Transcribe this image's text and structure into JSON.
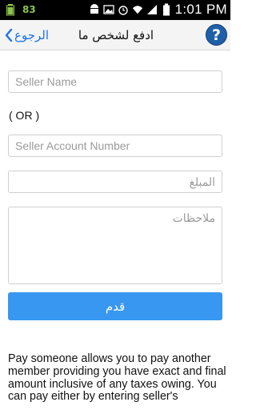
{
  "status_bar": {
    "left_number": "83",
    "time": "1:01",
    "time_suffix": "PM"
  },
  "header": {
    "back_label": "الرجوع",
    "title": "ادفع لشخص ما",
    "help_symbol": "?"
  },
  "form": {
    "seller_name_placeholder": "Seller Name",
    "or_label": "( OR )",
    "seller_account_placeholder": "Seller Account Number",
    "amount_placeholder": "المبلغ",
    "notes_placeholder": "ملاحظات",
    "submit_label": "قدم"
  },
  "description": "Pay someone allows you to pay another member providing you have exact and final amount inclusive of any taxes owing. You can pay either by entering seller's",
  "colors": {
    "accent": "#3897f0",
    "back_link": "#1e73e8",
    "help_button": "#1f5fa8",
    "status_bar": "#000000"
  }
}
